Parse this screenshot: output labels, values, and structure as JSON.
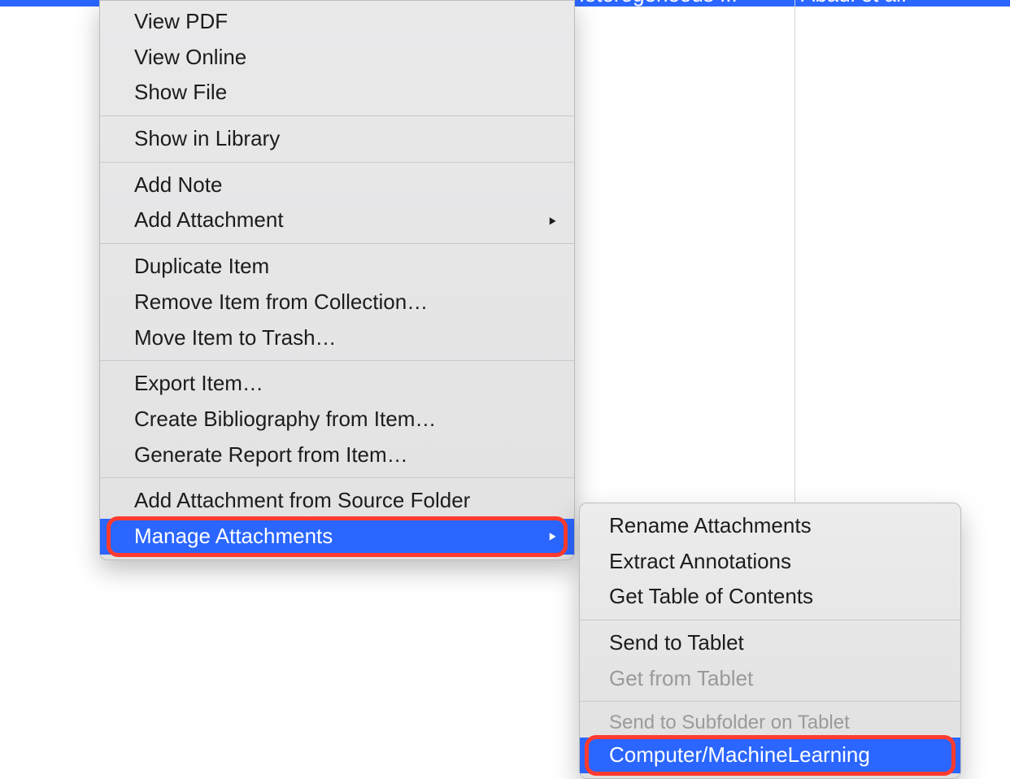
{
  "top_row": {
    "partial_title": "Heterogeneous ...",
    "partial_author": "Abadi et al."
  },
  "context_menu": {
    "groups": [
      {
        "items": [
          "View PDF",
          "View Online",
          "Show File"
        ]
      },
      {
        "items": [
          "Show in Library"
        ]
      },
      {
        "items": [
          "Add Note",
          {
            "label": "Add Attachment",
            "submenu": true
          }
        ]
      },
      {
        "items": [
          "Duplicate Item",
          "Remove Item from Collection…",
          "Move Item to Trash…"
        ]
      },
      {
        "items": [
          "Export Item…",
          "Create Bibliography from Item…",
          "Generate Report from Item…"
        ]
      },
      {
        "items": [
          "Add Attachment from Source Folder",
          {
            "label": "Manage Attachments",
            "submenu": true,
            "highlighted": true,
            "ringed": true
          }
        ]
      }
    ]
  },
  "submenu": {
    "groups": [
      {
        "items": [
          "Rename Attachments",
          "Extract Annotations",
          "Get Table of Contents"
        ]
      },
      {
        "items": [
          "Send to Tablet",
          {
            "label": "Get from Tablet",
            "disabled": true
          }
        ]
      },
      {
        "header": "Send to Subfolder on Tablet",
        "items": [
          {
            "label": "Computer/MachineLearning",
            "highlighted": true,
            "ringed": true
          }
        ]
      }
    ]
  }
}
